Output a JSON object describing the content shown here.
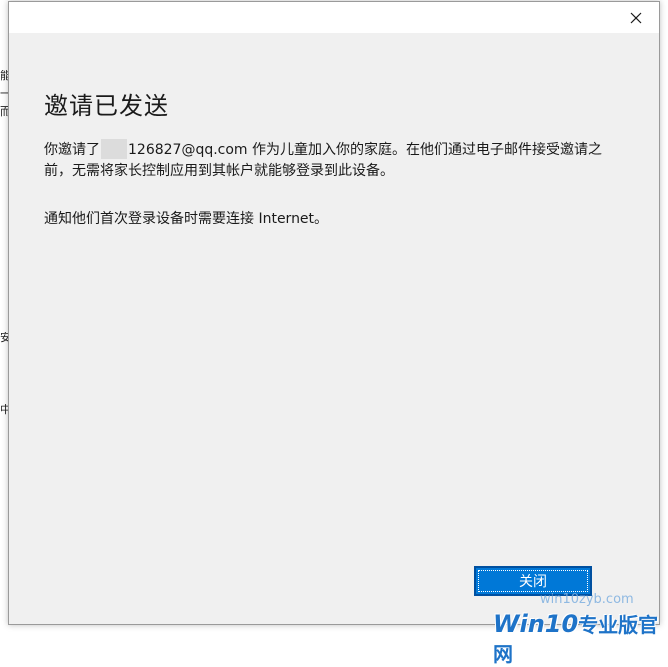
{
  "dialog": {
    "heading": "邀请已发送",
    "body_before": "你邀请了",
    "body_after": "126827@qq.com 作为儿童加入你的家庭。在他们通过电子邮件接受邀请之前，无需将家长控制应用到其帐户就能够登录到此设备。",
    "note": "通知他们首次登录设备时需要连接 Internet。",
    "close_button": "关闭",
    "titlebar_close_icon": "close-icon"
  },
  "background": {
    "glyphs": [
      "能",
      "一",
      "而",
      "安",
      "中"
    ]
  },
  "watermark": {
    "url": "win10zyb.com",
    "logo": "Win10",
    "logo_suffix": "专业版官网"
  },
  "colors": {
    "accent": "#0078d7",
    "dialog_bg": "#f0f0f0",
    "watermark": "#1e73c8"
  }
}
